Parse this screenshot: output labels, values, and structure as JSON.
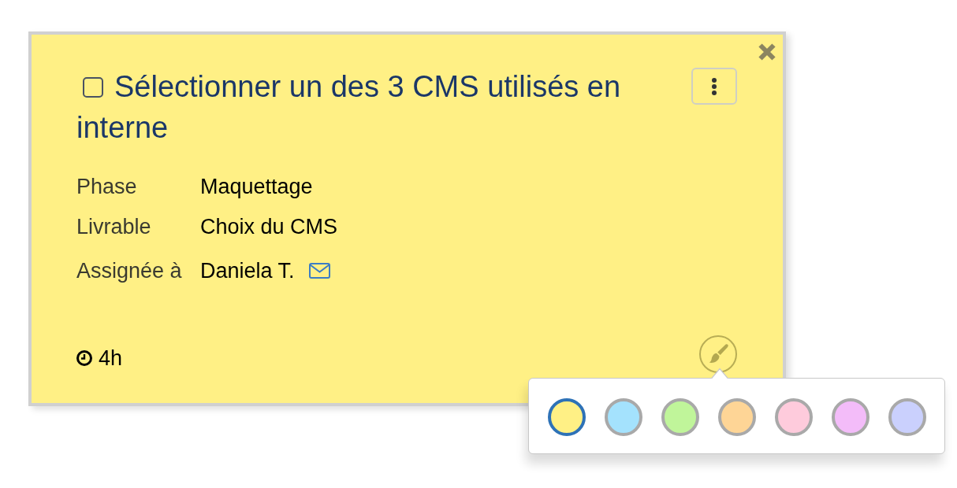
{
  "card": {
    "title": "Sélectionner un des 3 CMS utilisés en interne",
    "checked": false,
    "fields": [
      {
        "kind": "text",
        "label": "Phase",
        "value": "Maquettage"
      },
      {
        "kind": "text",
        "label": "Livrable",
        "value": "Choix du CMS"
      },
      {
        "kind": "contact",
        "label": "Assignée à",
        "value": "Daniela T."
      }
    ],
    "duration": "4h"
  },
  "color_picker": {
    "swatches": [
      {
        "color": "#fff085",
        "selected": true
      },
      {
        "color": "#a4e2fd",
        "selected": false
      },
      {
        "color": "#c0f59a",
        "selected": false
      },
      {
        "color": "#fed596",
        "selected": false
      },
      {
        "color": "#fecbdc",
        "selected": false
      },
      {
        "color": "#f3bcf9",
        "selected": false
      },
      {
        "color": "#cad0fd",
        "selected": false
      }
    ]
  }
}
